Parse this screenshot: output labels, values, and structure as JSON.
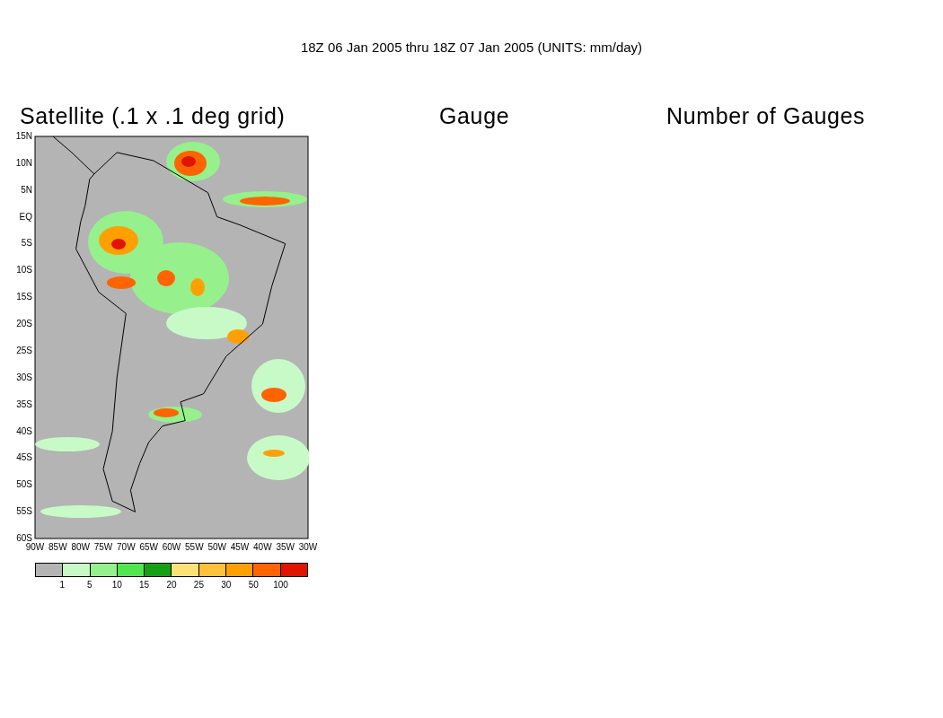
{
  "title": "18Z 06 Jan 2005 thru 18Z 07 Jan 2005 (UNITS: mm/day)",
  "panels": [
    {
      "title": "Satellite (.1 x .1 deg grid)"
    },
    {
      "title": "Gauge"
    },
    {
      "title": "Number of Gauges"
    }
  ],
  "map": {
    "y_labels": [
      "15N",
      "10N",
      "5N",
      "EQ",
      "5S",
      "10S",
      "15S",
      "20S",
      "25S",
      "30S",
      "35S",
      "40S",
      "45S",
      "50S",
      "55S",
      "60S"
    ],
    "x_labels": [
      "90W",
      "85W",
      "80W",
      "75W",
      "70W",
      "65W",
      "60W",
      "55W",
      "50W",
      "45W",
      "40W",
      "35W",
      "30W"
    ]
  },
  "legend": {
    "swatches": [
      {
        "color": "#b4b4b4"
      },
      {
        "color": "#c8fac8"
      },
      {
        "color": "#96f08c"
      },
      {
        "color": "#50e650"
      },
      {
        "color": "#14a014"
      },
      {
        "color": "#fae178"
      },
      {
        "color": "#ffc03c"
      },
      {
        "color": "#ffa000"
      },
      {
        "color": "#ff6400"
      },
      {
        "color": "#e11400"
      }
    ],
    "labels": [
      "1",
      "5",
      "10",
      "15",
      "20",
      "25",
      "30",
      "50",
      "100"
    ]
  }
}
